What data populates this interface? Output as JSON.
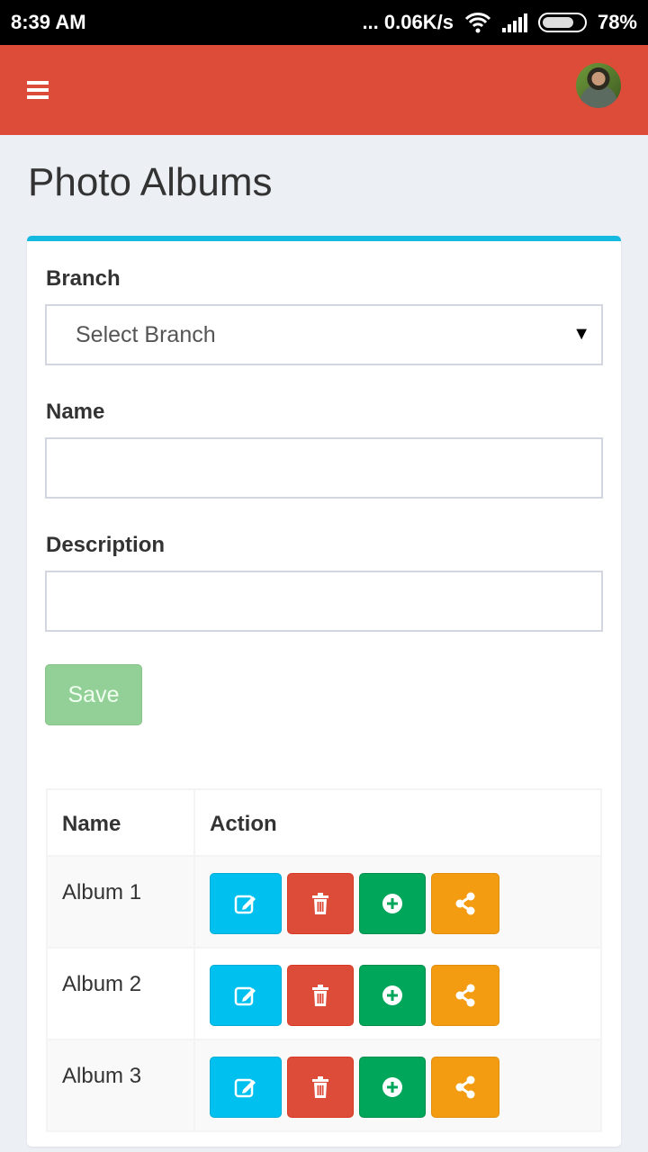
{
  "status_bar": {
    "time": "8:39 AM",
    "network_speed": "... 0.06K/s",
    "battery": "78%",
    "battery_level": 0.78,
    "icons": [
      "wifi-icon",
      "signal-icon",
      "battery-icon"
    ]
  },
  "app_bar": {
    "menu_icon": "hamburger-menu-icon",
    "avatar": "user-avatar"
  },
  "page": {
    "title": "Photo Albums"
  },
  "form": {
    "branch_label": "Branch",
    "branch_select": {
      "selected": "Select Branch"
    },
    "name_label": "Name",
    "name_value": "",
    "description_label": "Description",
    "description_value": "",
    "save_label": "Save"
  },
  "table": {
    "headers": [
      "Name",
      "Action"
    ],
    "rows": [
      {
        "name": "Album 1"
      },
      {
        "name": "Album 2"
      },
      {
        "name": "Album 3"
      }
    ],
    "actions": [
      "edit-icon",
      "trash-icon",
      "plus-circle-icon",
      "share-icon"
    ]
  },
  "colors": {
    "app_bar": "#dd4b39",
    "card_accent": "#14b9e0",
    "edit": "#00c0ef",
    "delete": "#dd4b39",
    "add": "#00a65a",
    "share": "#f39c12",
    "save": "#92d097"
  }
}
